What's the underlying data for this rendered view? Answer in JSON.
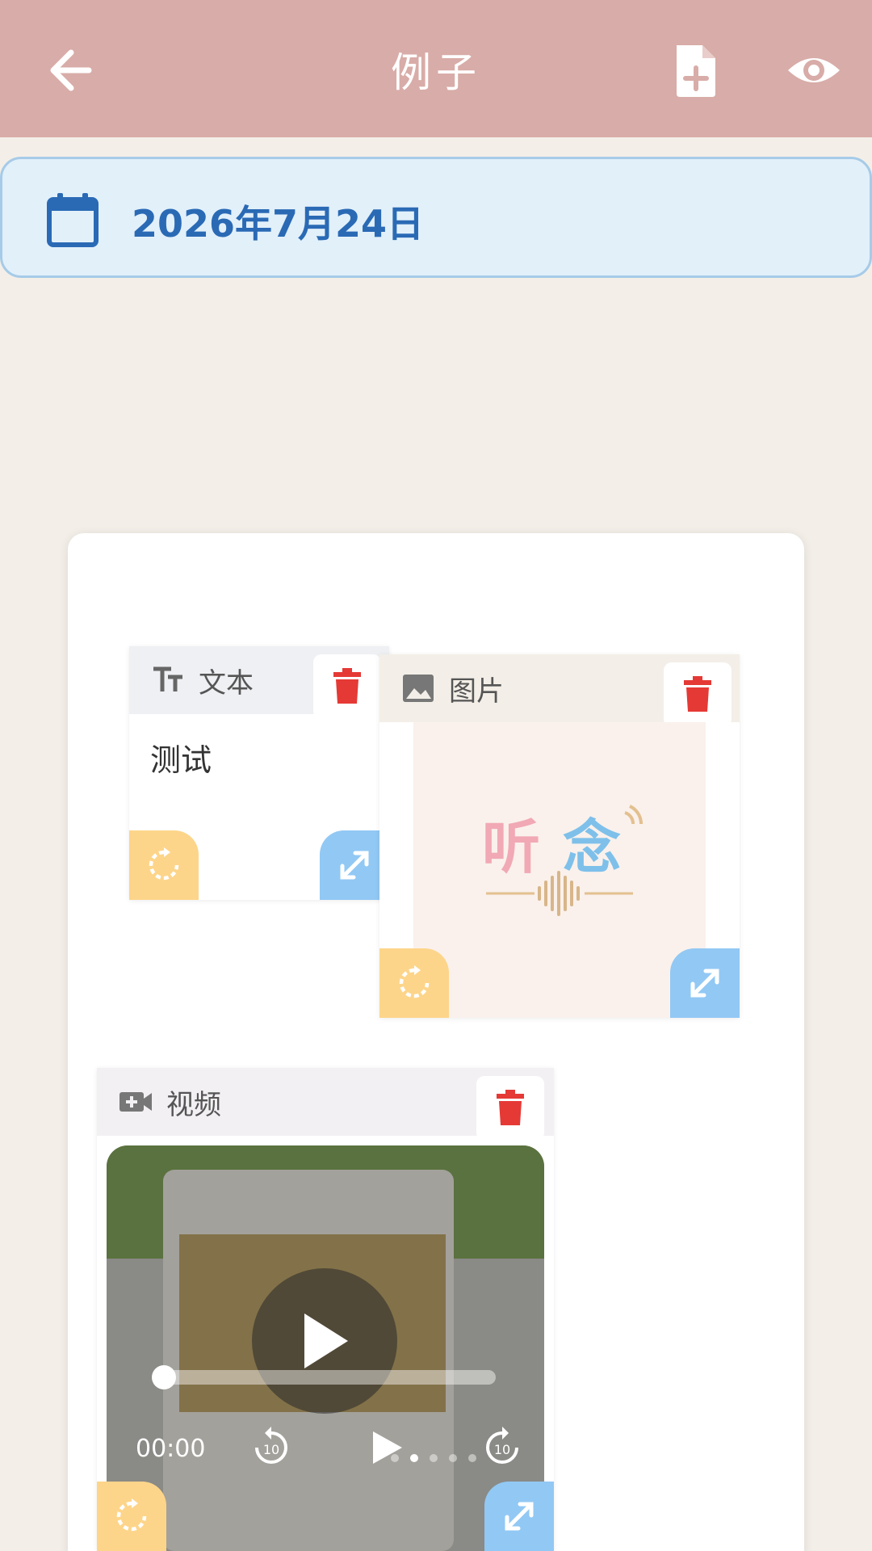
{
  "header": {
    "title": "例子",
    "back_icon": "arrow-left-icon",
    "add_icon": "file-plus-icon",
    "preview_icon": "eye-icon",
    "bg_color": "#d8aca8"
  },
  "date_bar": {
    "icon": "calendar-icon",
    "date": "2026年7月24日"
  },
  "widgets": {
    "text": {
      "type_label": "文本",
      "type_icon": "text-size-icon",
      "content": "测试"
    },
    "image": {
      "type_label": "图片",
      "type_icon": "image-icon",
      "logo_text": "听念"
    },
    "video": {
      "type_label": "视频",
      "type_icon": "video-plus-icon",
      "time": "00:00",
      "rewind_label": "10",
      "forward_label": "10",
      "progress": 0,
      "page_dots": 5,
      "active_dot": 1
    }
  },
  "colors": {
    "delete": "#e53935",
    "rotate": "#fdd58a",
    "expand": "#92c8f4",
    "date_text": "#2a6ab5"
  }
}
